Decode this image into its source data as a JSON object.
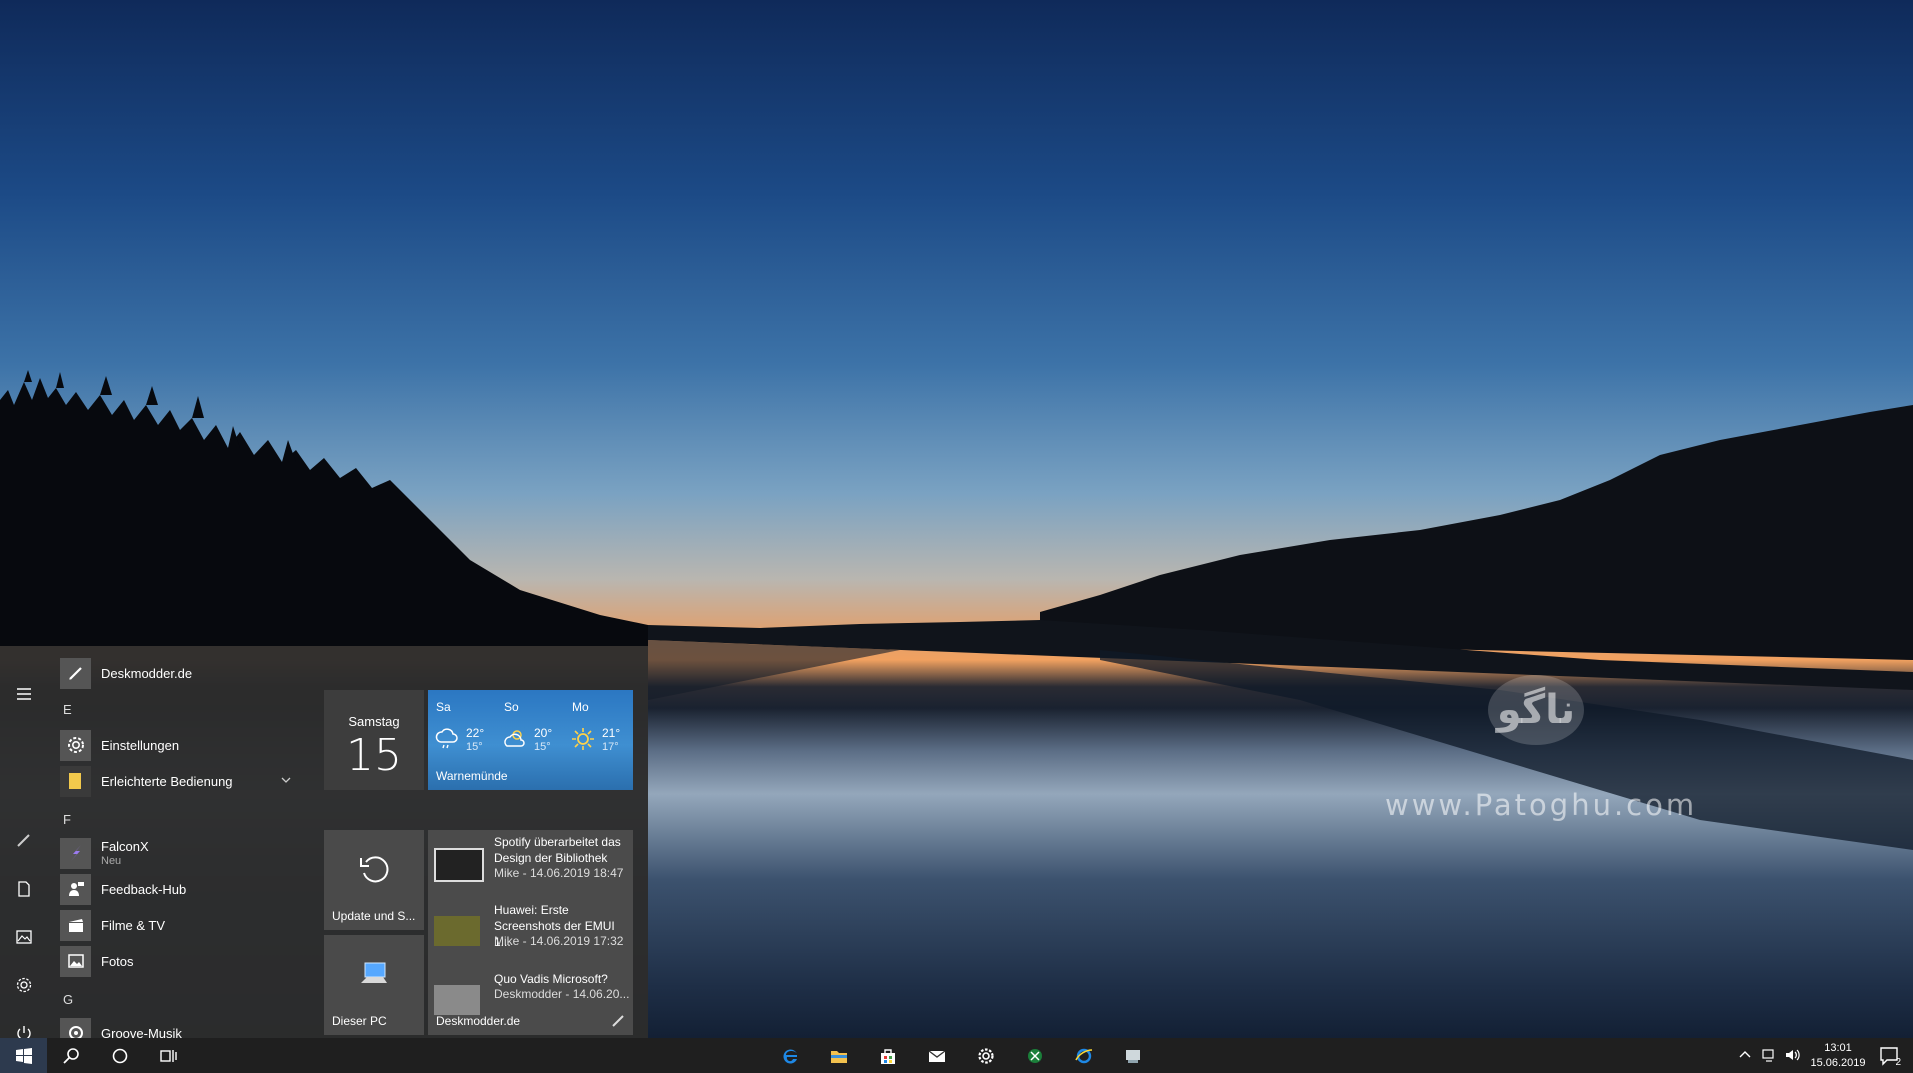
{
  "desktop": {
    "wallpaper": "lake-sunset",
    "watermark_logo_text": "ناگو",
    "watermark_url": "www.Patoghu.com"
  },
  "start_menu": {
    "rail": [
      {
        "name": "hamburger-menu-icon"
      },
      {
        "name": "pen-icon"
      },
      {
        "name": "document-icon"
      },
      {
        "name": "pictures-icon"
      },
      {
        "name": "settings-gear-icon"
      },
      {
        "name": "power-icon"
      }
    ],
    "apps": {
      "pinned": {
        "label": "Deskmodder.de",
        "icon": "pen-icon"
      },
      "letters": [
        "E",
        "F",
        "G"
      ],
      "items": [
        {
          "label": "Einstellungen",
          "icon": "gear-icon",
          "sub": ""
        },
        {
          "label": "Erleichterte Bedienung",
          "icon": "folder-icon",
          "sub": ""
        },
        {
          "label": "FalconX",
          "icon": "falcon-icon",
          "sub": "Neu"
        },
        {
          "label": "Feedback-Hub",
          "icon": "feedback-icon",
          "sub": ""
        },
        {
          "label": "Filme & TV",
          "icon": "film-icon",
          "sub": ""
        },
        {
          "label": "Fotos",
          "icon": "photos-icon",
          "sub": ""
        },
        {
          "label": "Groove-Musik",
          "icon": "music-icon",
          "sub": ""
        }
      ]
    },
    "tiles": {
      "calendar": {
        "day": "Samstag",
        "date": "15"
      },
      "weather": {
        "location": "Warnemünde",
        "days": [
          {
            "name": "Sa",
            "icon": "cloud-rain-icon",
            "hi": "22°",
            "lo": "15°"
          },
          {
            "name": "So",
            "icon": "partly-cloudy-icon",
            "hi": "20°",
            "lo": "15°"
          },
          {
            "name": "Mo",
            "icon": "sun-icon",
            "hi": "21°",
            "lo": "17°"
          }
        ]
      },
      "update": {
        "label": "Update und S..."
      },
      "this_pc": {
        "label": "Dieser PC"
      },
      "news": {
        "source": "Deskmodder.de",
        "items": [
          {
            "title": "Spotify überarbeitet das Design der Bibliothek",
            "meta": "Mike - 14.06.2019 18:47"
          },
          {
            "title": "Huawei: Erste Screenshots der EMUI 1...",
            "meta": "Mike - 14.06.2019 17:32"
          },
          {
            "title": "Quo Vadis Microsoft?",
            "meta": "Deskmodder - 14.06.20..."
          }
        ]
      }
    }
  },
  "taskbar": {
    "left": [
      "windows-start-icon",
      "search-icon",
      "cortana-icon",
      "task-view-icon"
    ],
    "pinned": [
      "edge-icon",
      "file-explorer-icon",
      "store-icon",
      "mail-icon",
      "settings-icon",
      "xbox-icon",
      "internet-explorer-icon",
      "app-icon"
    ],
    "tray": [
      "chevron-up-icon",
      "network-icon",
      "volume-icon"
    ],
    "time": "13:01",
    "date": "15.06.2019",
    "notifications": "2"
  }
}
